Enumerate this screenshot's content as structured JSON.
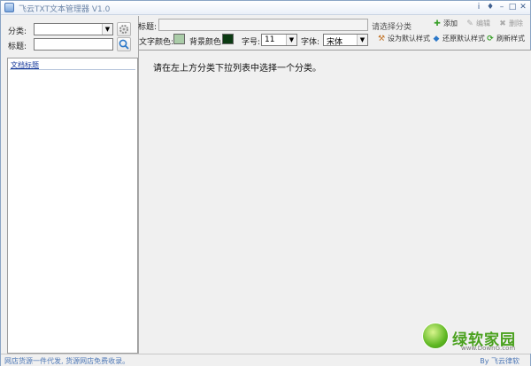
{
  "window": {
    "title": "飞云TXT文本管理器 V1.0",
    "controls": [
      "i",
      "♦",
      "–",
      "□",
      "✕"
    ]
  },
  "left": {
    "category_label": "分类:",
    "category_value": "",
    "title_label": "标题:",
    "title_value": "",
    "list_header": "文档标题"
  },
  "right": {
    "title_label": "标题:",
    "title_value": "",
    "select_category_hint": "请选择分类",
    "add_label": "添加",
    "edit_label": "编辑",
    "delete_label": "删除",
    "text_color_label": "文字颜色:",
    "text_color": "#aacca8",
    "bg_color_label": "背景颜色:",
    "bg_color": "#0b3a12",
    "font_size_label": "字号:",
    "font_size_value": "11",
    "font_face_label": "字体:",
    "font_face_value": "宋体",
    "set_default_label": "设为默认样式",
    "restore_default_label": "还原默认样式",
    "refresh_label": "刷新样式",
    "content_hint": "请在左上方分类下拉列表中选择一个分类。"
  },
  "status": {
    "left_text": "网店货源一件代发, 货源网店免费收录。",
    "right_text": "By 飞云律软"
  },
  "watermark": {
    "logo_text": "绿软家园",
    "url": "www.DownG.com"
  },
  "colors": {
    "accent": "#4d77b6",
    "add_green": "#3aa02a",
    "window_bg": "#f0f0f0"
  }
}
